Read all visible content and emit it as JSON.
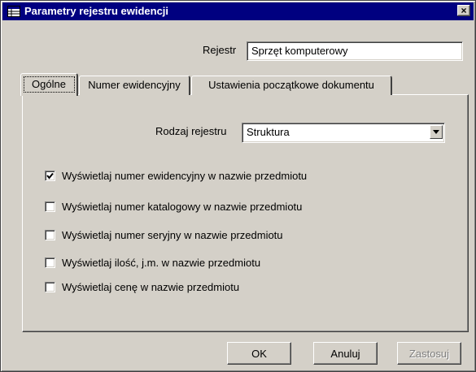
{
  "window": {
    "title": "Parametry rejestru ewidencji",
    "close_label": "×"
  },
  "rejestr": {
    "label": "Rejestr",
    "value": "Sprzęt komputerowy"
  },
  "tabs": [
    {
      "label": "Ogólne",
      "active": true
    },
    {
      "label": "Numer ewidencyjny",
      "active": false
    },
    {
      "label": "Ustawienia początkowe dokumentu",
      "active": false
    }
  ],
  "rodzaj": {
    "label": "Rodzaj rejestru",
    "value": "Struktura"
  },
  "options": [
    {
      "label": "Wyświetlaj numer ewidencyjny w nazwie przedmiotu",
      "checked": true
    },
    {
      "label": "Wyświetlaj numer katalogowy w nazwie przedmiotu",
      "checked": false
    },
    {
      "label": "Wyświetlaj numer seryjny w nazwie przedmiotu",
      "checked": false
    },
    {
      "label": "Wyświetlaj ilość, j.m. w nazwie przedmiotu",
      "checked": false
    },
    {
      "label": "Wyświetlaj cenę w nazwie przedmiotu",
      "checked": false
    }
  ],
  "buttons": {
    "ok": "OK",
    "cancel": "Anuluj",
    "apply": "Zastosuj"
  }
}
